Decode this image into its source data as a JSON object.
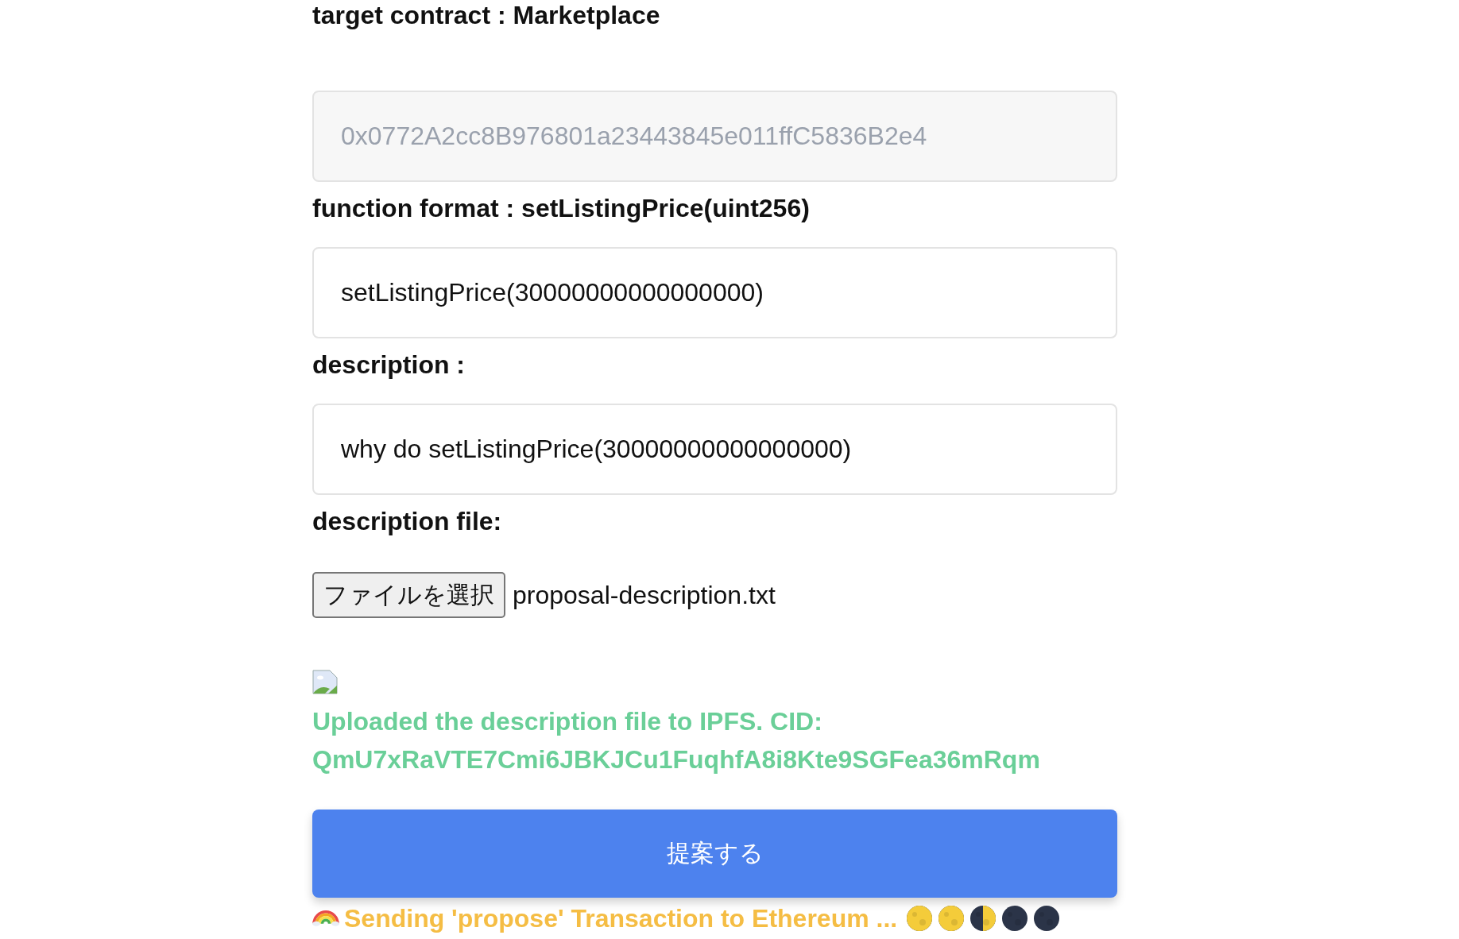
{
  "form": [
    {
      "kind": "label",
      "text": "target contract : Marketplace"
    },
    {
      "kind": "field",
      "placeholder": "0x0772A2cc8B976801a23443845e011ffC5836B2e4",
      "disabled": true
    },
    {
      "kind": "label",
      "text": "function format : setListingPrice(uint256)"
    },
    {
      "kind": "field",
      "value": "setListingPrice(30000000000000000)",
      "disabled": false
    },
    {
      "kind": "label",
      "text": "description :"
    },
    {
      "kind": "field",
      "value": "why do setListingPrice(30000000000000000)",
      "disabled": false
    },
    {
      "kind": "label",
      "text": "description file:"
    },
    {
      "kind": "file",
      "button": "ファイルを選択",
      "filename": "proposal-description.txt"
    }
  ],
  "upload": {
    "message": "Uploaded the description file to IPFS. CID:",
    "cid": "QmU7xRaVTE7Cmi6JBKJCu1FuqhfA8i8Kte9SGFea36mRqm"
  },
  "submit_button": "提案する",
  "status": {
    "text": "Sending 'propose' Transaction to Ethereum ..."
  }
}
